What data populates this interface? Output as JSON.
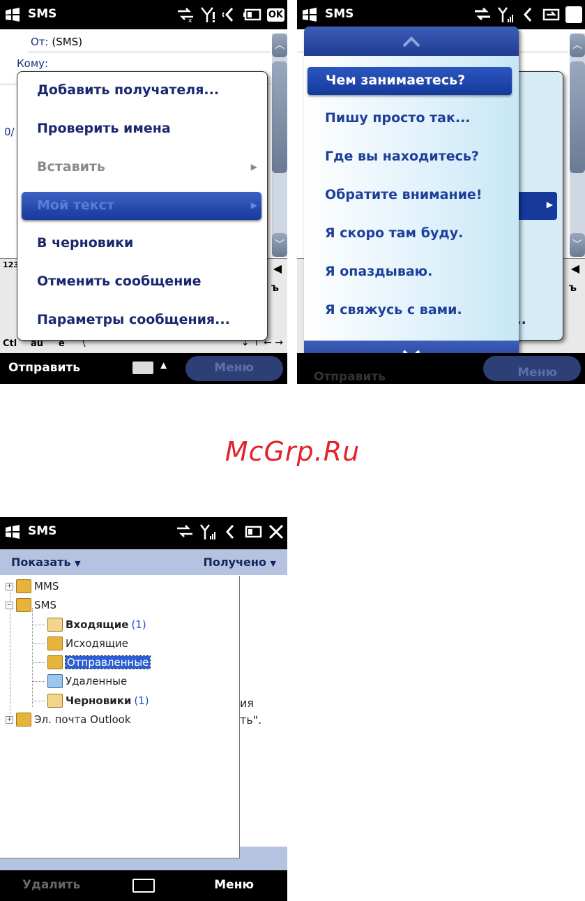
{
  "screen1": {
    "title": "SMS",
    "ok_label": "OK",
    "from_label": "От:",
    "from_value": "(SMS)",
    "to_label": "Кому:",
    "counter_fragment": "0/",
    "context_menu": [
      {
        "label": "Добавить получателя...",
        "enabled": true
      },
      {
        "label": "Проверить имена",
        "enabled": true
      },
      {
        "label": "Вставить",
        "enabled": false,
        "submenu": true
      },
      {
        "label": "Мой текст",
        "enabled": true,
        "submenu": true,
        "selected": true
      },
      {
        "label": "В черновики",
        "enabled": true
      },
      {
        "label": "Отменить сообщение",
        "enabled": true
      },
      {
        "label": "Параметры сообщения...",
        "enabled": true
      }
    ],
    "keyboard_keys": {
      "k123": "123",
      "ctl": "Ctl",
      "au": "áü",
      "e": "е",
      "backslash": "\\",
      "hard_sign": "ъ"
    },
    "softkey_left": "Отправить",
    "softkey_right": "Меню"
  },
  "screen2": {
    "title": "SMS",
    "my_text_items": [
      "Чем занимаетесь?",
      "Пишу просто так...",
      "Где вы находитесь?",
      "Обратите внимание!",
      "Я скоро там буду.",
      "Я опаздываю.",
      "Я свяжусь с вами."
    ],
    "partial_right": "я...",
    "softkey_left_partial": "Отправить",
    "softkey_right_partial": "Меню",
    "hard_sign": "ъ"
  },
  "watermark": "McGrp.Ru",
  "screen3": {
    "title": "SMS",
    "show_menu": "Показать",
    "sort_menu": "Получено",
    "tree": [
      {
        "label": "MMS",
        "level": 0,
        "expander": "+"
      },
      {
        "label": "SMS",
        "level": 0,
        "expander": "−"
      },
      {
        "label": "Входящие",
        "level": 1,
        "bold": true,
        "count": "(1)"
      },
      {
        "label": "Исходящие",
        "level": 1
      },
      {
        "label": "Отправленные",
        "level": 1,
        "selected": true
      },
      {
        "label": "Удаленные",
        "level": 1
      },
      {
        "label": "Черновики",
        "level": 1,
        "bold": true,
        "count": "(1)"
      },
      {
        "label": "Эл. почта Outlook",
        "level": 0,
        "expander": "+"
      }
    ],
    "behind_text_1": "ия",
    "behind_text_2": "ть\".",
    "softkey_left": "Удалить",
    "softkey_right": "Меню"
  },
  "colors": {
    "menu_text": "#1b2870",
    "highlight": "#17399c",
    "toolbar": "#b6c3e0",
    "watermark": "#e3232a"
  }
}
